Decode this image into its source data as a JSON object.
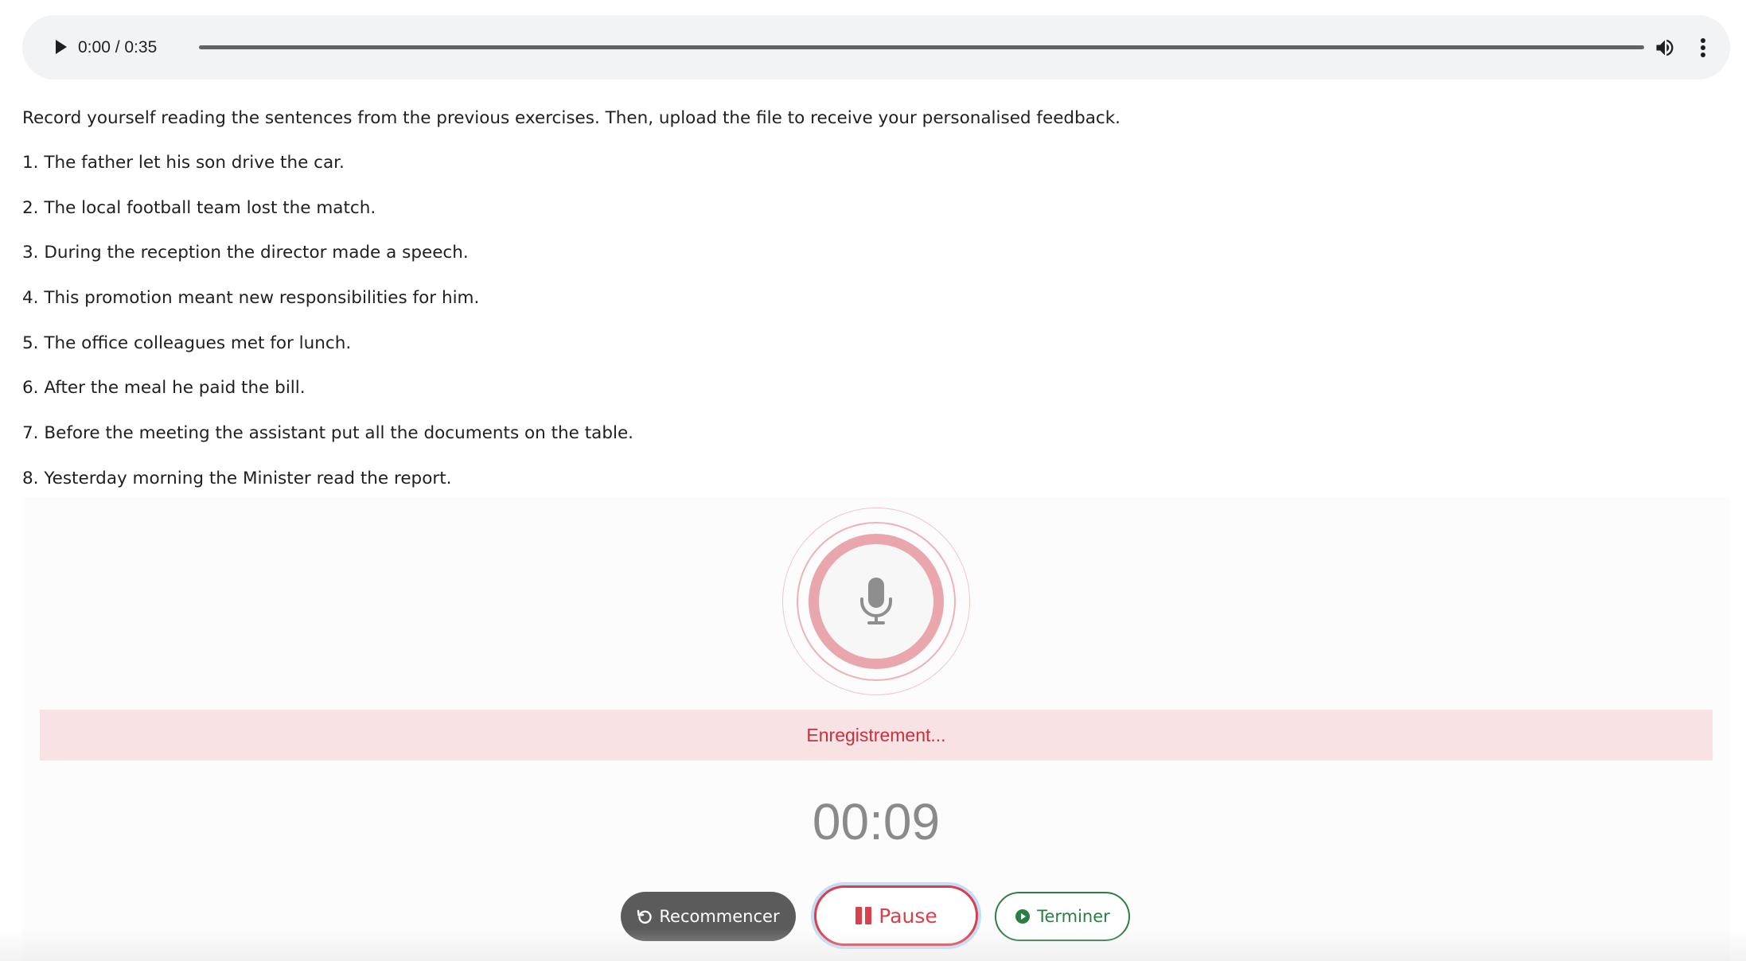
{
  "audio_player": {
    "time_display": "0:00 / 0:35",
    "play_icon": "play-icon",
    "volume_icon": "volume-icon",
    "menu_icon": "more-vertical-icon"
  },
  "instructions": "Record yourself reading the sentences from the previous exercises. Then, upload the file to receive your personalised feedback.",
  "sentences": [
    "1. The father let his son drive the car.",
    "2. The local football team lost the match.",
    "3. During the reception the director made a speech.",
    "4. This promotion meant new responsibilities for him.",
    "5. The office colleagues met for lunch.",
    "6. After the meal he paid the bill.",
    "7. Before the meeting the assistant put all the documents on the table.",
    "8. Yesterday morning the Minister read the report."
  ],
  "recorder": {
    "mic_icon": "microphone-icon",
    "status_text": "Enregistrement...",
    "timer": "00:09",
    "buttons": {
      "restart_label": "Recommencer",
      "pause_label": "Pause",
      "finish_label": "Terminer"
    }
  },
  "colors": {
    "recording_red": "#d9404b",
    "finish_green": "#2d7d46",
    "status_background": "#f8e2e4",
    "player_background": "#f1f3f4"
  }
}
